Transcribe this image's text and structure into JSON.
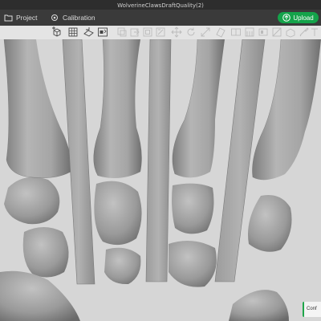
{
  "window": {
    "title": "WolverineClawsDraftQuality(2)"
  },
  "tabs": [
    {
      "label": "Project",
      "icon": "folder-icon"
    },
    {
      "label": "Calibration",
      "icon": "calibration-icon"
    }
  ],
  "upload": {
    "label": "Upload",
    "icon": "upload-icon"
  },
  "toolbar": {
    "tools": [
      "add-model-icon",
      "grid-icon",
      "plate-icon",
      "layout-icon",
      "copy-icon",
      "edit-icon",
      "delete-icon",
      "select-icon",
      "move-icon",
      "rotate-icon",
      "scale-icon",
      "cut-icon",
      "split-icon",
      "support-icon",
      "seam-icon",
      "color-icon",
      "measure-icon",
      "assemble-icon",
      "text-icon",
      "variable-layer-icon"
    ]
  },
  "viewport": {
    "scene": "3D model of bone fragments with vertical claw blades",
    "colors": {
      "background": "#d6d6d6",
      "bone": "#9a9a9a",
      "blade": "#a8a8a8"
    }
  },
  "notification": {
    "text": "Conf"
  }
}
